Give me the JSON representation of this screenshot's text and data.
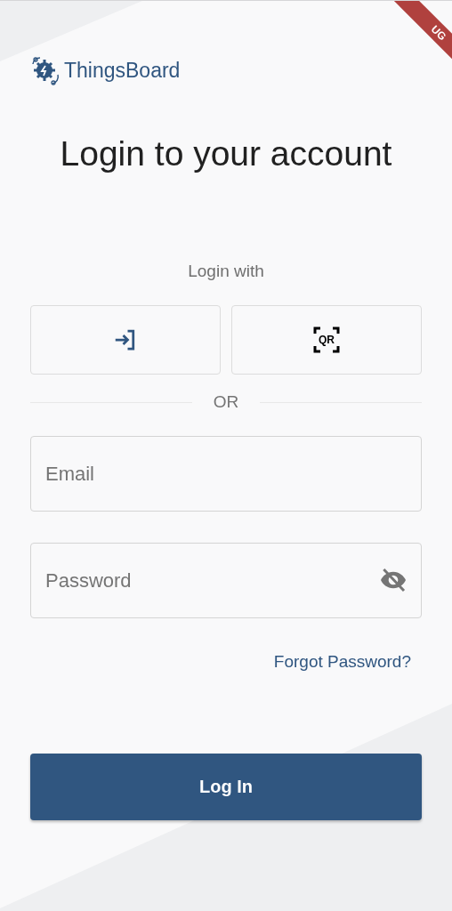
{
  "debug_banner": {
    "text": "UG"
  },
  "logo": {
    "text": "ThingsBoard"
  },
  "title": "Login to your account",
  "login_with": "Login with",
  "login_options": [
    {
      "kind": "sso"
    },
    {
      "kind": "qr",
      "text": "QR"
    }
  ],
  "divider_text": "OR",
  "email": {
    "placeholder": "Email"
  },
  "password": {
    "placeholder": "Password",
    "visible": false
  },
  "forgot_password": "Forgot Password?",
  "login_button": "Log In"
}
